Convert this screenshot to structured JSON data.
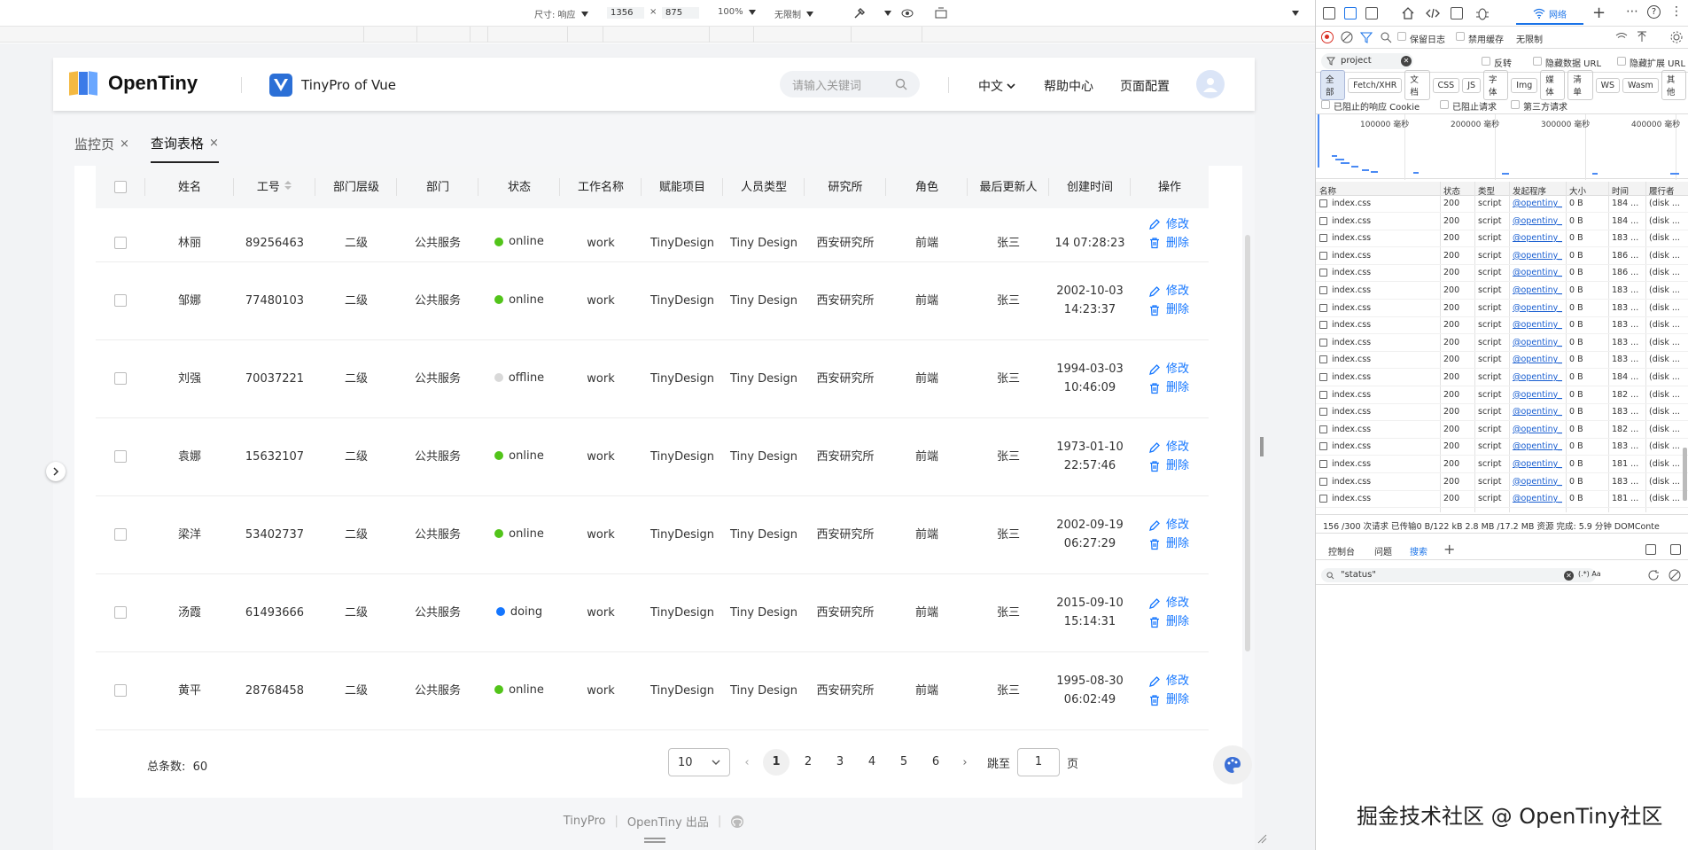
{
  "device_toolbar": {
    "dimensions_label": "尺寸: 响应",
    "width": "1356",
    "times": "×",
    "height": "875",
    "zoom": "100%",
    "throttle": "无限制"
  },
  "app": {
    "logo_text": "OpenTiny",
    "product_title": "TinyPro of Vue",
    "search_placeholder": "请输入关键词",
    "nav": {
      "language": "中文",
      "help": "帮助中心",
      "page_config": "页面配置"
    }
  },
  "tabs": [
    {
      "label": "监控页",
      "close": "×"
    },
    {
      "label": "查询表格",
      "close": "×"
    }
  ],
  "table": {
    "headers": [
      "姓名",
      "工号",
      "部门层级",
      "部门",
      "状态",
      "工作名称",
      "赋能项目",
      "人员类型",
      "研究所",
      "角色",
      "最后更新人",
      "创建时间",
      "操作"
    ],
    "edit_label": "修改",
    "delete_label": "删除",
    "partial_row": {
      "name": "林丽",
      "id": "89256463",
      "level": "二级",
      "dept": "公共服务",
      "status": "online",
      "job": "work",
      "project": "TinyDesign",
      "type": "Tiny Design",
      "institute": "西安研究所",
      "role": "前端",
      "updater": "张三",
      "created": "14 07:28:23"
    },
    "rows": [
      {
        "name": "邹娜",
        "id": "77480103",
        "level": "二级",
        "dept": "公共服务",
        "status": "online",
        "job": "work",
        "project": "TinyDesign",
        "type": "Tiny Design",
        "institute": "西安研究所",
        "role": "前端",
        "updater": "张三",
        "created": "2002-10-03 14:23:37"
      },
      {
        "name": "刘强",
        "id": "70037221",
        "level": "二级",
        "dept": "公共服务",
        "status": "offline",
        "job": "work",
        "project": "TinyDesign",
        "type": "Tiny Design",
        "institute": "西安研究所",
        "role": "前端",
        "updater": "张三",
        "created": "1994-03-03 10:46:09"
      },
      {
        "name": "袁娜",
        "id": "15632107",
        "level": "二级",
        "dept": "公共服务",
        "status": "online",
        "job": "work",
        "project": "TinyDesign",
        "type": "Tiny Design",
        "institute": "西安研究所",
        "role": "前端",
        "updater": "张三",
        "created": "1973-01-10 22:57:46"
      },
      {
        "name": "梁洋",
        "id": "53402737",
        "level": "二级",
        "dept": "公共服务",
        "status": "online",
        "job": "work",
        "project": "TinyDesign",
        "type": "Tiny Design",
        "institute": "西安研究所",
        "role": "前端",
        "updater": "张三",
        "created": "2002-09-19 06:27:29"
      },
      {
        "name": "汤霞",
        "id": "61493666",
        "level": "二级",
        "dept": "公共服务",
        "status": "doing",
        "job": "work",
        "project": "TinyDesign",
        "type": "Tiny Design",
        "institute": "西安研究所",
        "role": "前端",
        "updater": "张三",
        "created": "2015-09-10 15:14:31"
      },
      {
        "name": "黄平",
        "id": "28768458",
        "level": "二级",
        "dept": "公共服务",
        "status": "online",
        "job": "work",
        "project": "TinyDesign",
        "type": "Tiny Design",
        "institute": "西安研究所",
        "role": "前端",
        "updater": "张三",
        "created": "1995-08-30 06:02:49"
      }
    ],
    "status_colors": {
      "online": "#52c41a",
      "offline": "#d9d9d9",
      "doing": "#1476ff"
    }
  },
  "pagination": {
    "total_label": "总条数:",
    "total": "60",
    "page_size": "10",
    "pages": [
      "1",
      "2",
      "3",
      "4",
      "5",
      "6"
    ],
    "current": "1",
    "prev": "‹",
    "next": "›",
    "jump_label": "跳至",
    "jump_value": "1",
    "page_unit": "页"
  },
  "footer": {
    "left": "TinyPro",
    "right": "OpenTiny 出品"
  },
  "devtools": {
    "active_tab": "网络",
    "preserve_log": "保留日志",
    "disable_cache": "禁用缓存",
    "throttle": "无限制",
    "filter_value": "project",
    "invert": "反转",
    "hide_data_url": "隐藏数据 URL",
    "hide_ext_url": "隐藏扩展 URL",
    "type_filters": [
      "全部",
      "Fetch/XHR",
      "文档",
      "CSS",
      "JS",
      "字体",
      "Img",
      "媒体",
      "清单",
      "WS",
      "Wasm",
      "其他"
    ],
    "blocked_cookies": "已阻止的响应 Cookie",
    "blocked_requests": "已阻止请求",
    "third_party": "第三方请求",
    "overview_ticks": [
      "100000 毫秒",
      "200000 毫秒",
      "300000 毫秒",
      "400000 毫秒"
    ],
    "columns": [
      "名称",
      "状态",
      "类型",
      "发起程序",
      "大小",
      "时间",
      "履行者"
    ],
    "requests": [
      {
        "name": "index.css",
        "status": "200",
        "type": "script",
        "initiator": "@opentiny_vu",
        "size": "0 B",
        "time": "184 ...",
        "fulfilled": "(disk ..."
      },
      {
        "name": "index.css",
        "status": "200",
        "type": "script",
        "initiator": "@opentiny_vu",
        "size": "0 B",
        "time": "184 ...",
        "fulfilled": "(disk ..."
      },
      {
        "name": "index.css",
        "status": "200",
        "type": "script",
        "initiator": "@opentiny_vu",
        "size": "0 B",
        "time": "183 ...",
        "fulfilled": "(disk ..."
      },
      {
        "name": "index.css",
        "status": "200",
        "type": "script",
        "initiator": "@opentiny_vu",
        "size": "0 B",
        "time": "186 ...",
        "fulfilled": "(disk ..."
      },
      {
        "name": "index.css",
        "status": "200",
        "type": "script",
        "initiator": "@opentiny_vu",
        "size": "0 B",
        "time": "186 ...",
        "fulfilled": "(disk ..."
      },
      {
        "name": "index.css",
        "status": "200",
        "type": "script",
        "initiator": "@opentiny_vu",
        "size": "0 B",
        "time": "183 ...",
        "fulfilled": "(disk ..."
      },
      {
        "name": "index.css",
        "status": "200",
        "type": "script",
        "initiator": "@opentiny_vu",
        "size": "0 B",
        "time": "183 ...",
        "fulfilled": "(disk ..."
      },
      {
        "name": "index.css",
        "status": "200",
        "type": "script",
        "initiator": "@opentiny_vu",
        "size": "0 B",
        "time": "183 ...",
        "fulfilled": "(disk ..."
      },
      {
        "name": "index.css",
        "status": "200",
        "type": "script",
        "initiator": "@opentiny_vu",
        "size": "0 B",
        "time": "183 ...",
        "fulfilled": "(disk ..."
      },
      {
        "name": "index.css",
        "status": "200",
        "type": "script",
        "initiator": "@opentiny_vu",
        "size": "0 B",
        "time": "183 ...",
        "fulfilled": "(disk ..."
      },
      {
        "name": "index.css",
        "status": "200",
        "type": "script",
        "initiator": "@opentiny_vu",
        "size": "0 B",
        "time": "184 ...",
        "fulfilled": "(disk ..."
      },
      {
        "name": "index.css",
        "status": "200",
        "type": "script",
        "initiator": "@opentiny_vu",
        "size": "0 B",
        "time": "182 ...",
        "fulfilled": "(disk ..."
      },
      {
        "name": "index.css",
        "status": "200",
        "type": "script",
        "initiator": "@opentiny_vu",
        "size": "0 B",
        "time": "183 ...",
        "fulfilled": "(disk ..."
      },
      {
        "name": "index.css",
        "status": "200",
        "type": "script",
        "initiator": "@opentiny_vu",
        "size": "0 B",
        "time": "182 ...",
        "fulfilled": "(disk ..."
      },
      {
        "name": "index.css",
        "status": "200",
        "type": "script",
        "initiator": "@opentiny_vu",
        "size": "0 B",
        "time": "183 ...",
        "fulfilled": "(disk ..."
      },
      {
        "name": "index.css",
        "status": "200",
        "type": "script",
        "initiator": "@opentiny_vu",
        "size": "0 B",
        "time": "181 ...",
        "fulfilled": "(disk ..."
      },
      {
        "name": "index.css",
        "status": "200",
        "type": "script",
        "initiator": "@opentiny_vu",
        "size": "0 B",
        "time": "183 ...",
        "fulfilled": "(disk ..."
      },
      {
        "name": "index.css",
        "status": "200",
        "type": "script",
        "initiator": "@opentiny_vu",
        "size": "0 B",
        "time": "181 ...",
        "fulfilled": "(disk ..."
      }
    ],
    "summary": "156 /300 次请求   已传输0 B/122 kB   2.8 MB /17.2 MB 资源   完成: 5.9 分钟   DOMConte",
    "drawer_tabs": [
      "控制台",
      "问题",
      "搜索"
    ],
    "search_query": "\"status\"",
    "search_opts": "(.*)  Aa"
  },
  "watermark": "掘金技术社区 @ OpenTiny社区"
}
